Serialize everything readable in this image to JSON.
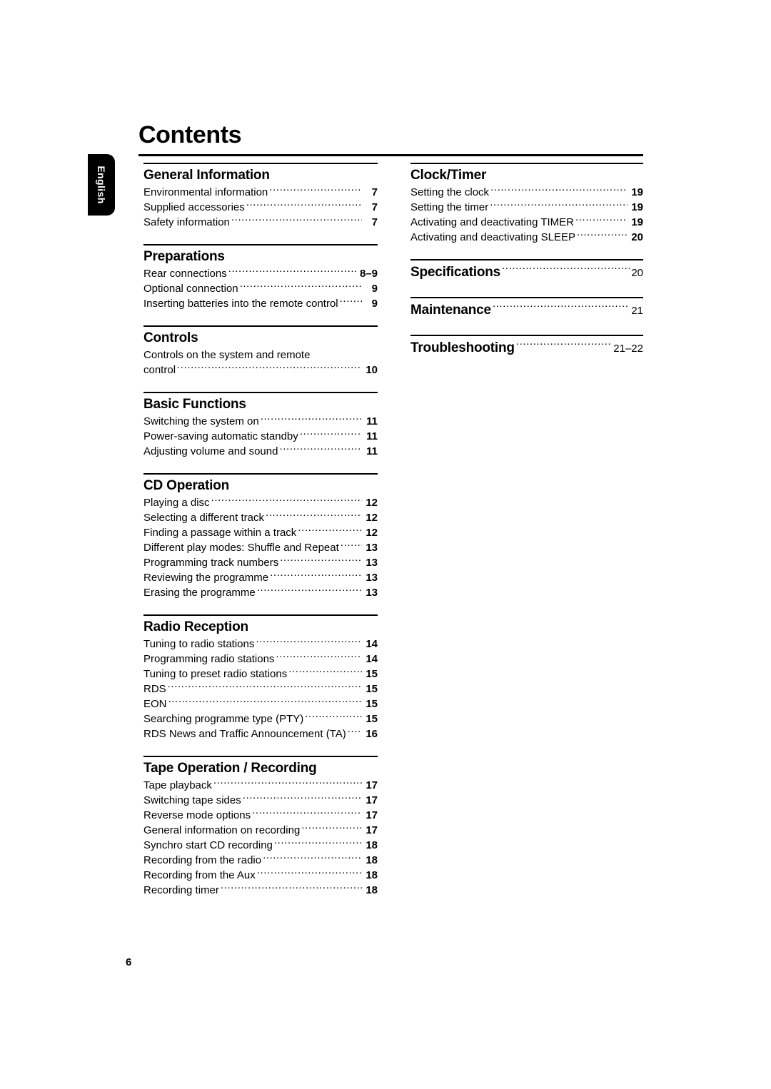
{
  "document": {
    "title": "Contents",
    "folio": "6",
    "language_tab": "English"
  },
  "left_column": {
    "sections": [
      {
        "title": "General Information",
        "entries": [
          {
            "label": "Environmental information",
            "page": "7"
          },
          {
            "label": "Supplied accessories",
            "page": "7"
          },
          {
            "label": "Safety information",
            "page": "7"
          }
        ]
      },
      {
        "title": "Preparations",
        "entries": [
          {
            "label": "Rear connections",
            "page": "8–9"
          },
          {
            "label": "Optional connection",
            "page": "9"
          },
          {
            "label": "Inserting batteries into the remote control",
            "page": "9"
          }
        ]
      },
      {
        "title": "Controls",
        "wrapped_entry": {
          "line1": "Controls on the system and remote",
          "line2": "control",
          "page": "10"
        },
        "entries": []
      },
      {
        "title": "Basic Functions",
        "entries": [
          {
            "label": "Switching the system on",
            "page": "11"
          },
          {
            "label": "Power-saving automatic standby",
            "page": "11"
          },
          {
            "label": "Adjusting volume and sound",
            "page": "11"
          }
        ]
      },
      {
        "title": "CD Operation",
        "entries": [
          {
            "label": "Playing a disc",
            "page": "12"
          },
          {
            "label": "Selecting a different track",
            "page": "12"
          },
          {
            "label": "Finding a passage within a track",
            "page": "12"
          },
          {
            "label": "Different play modes: Shuffle and Repeat",
            "page": "13"
          },
          {
            "label": "Programming track numbers",
            "page": "13"
          },
          {
            "label": "Reviewing the programme",
            "page": "13"
          },
          {
            "label": "Erasing the programme",
            "page": "13"
          }
        ]
      },
      {
        "title": "Radio Reception",
        "entries": [
          {
            "label": "Tuning to radio stations",
            "page": "14"
          },
          {
            "label": "Programming radio stations",
            "page": "14"
          },
          {
            "label": "Tuning to preset radio stations",
            "page": "15"
          },
          {
            "label": "RDS",
            "page": "15"
          },
          {
            "label": "EON",
            "page": "15"
          },
          {
            "label": "Searching programme type (PTY)",
            "page": "15"
          },
          {
            "label": "RDS News and Traffic Announcement (TA)",
            "page": "16"
          }
        ]
      },
      {
        "title": "Tape Operation / Recording",
        "entries": [
          {
            "label": "Tape playback",
            "page": "17"
          },
          {
            "label": "Switching tape sides",
            "page": "17"
          },
          {
            "label": "Reverse mode options",
            "page": "17"
          },
          {
            "label": "General information on recording",
            "page": "17"
          },
          {
            "label": "Synchro start CD recording",
            "page": "18"
          },
          {
            "label": "Recording from the radio",
            "page": "18"
          },
          {
            "label": "Recording from the Aux",
            "page": "18"
          },
          {
            "label": "Recording timer",
            "page": "18"
          }
        ]
      }
    ]
  },
  "right_column": {
    "sections": [
      {
        "title": "Clock/Timer",
        "entries": [
          {
            "label": "Setting the clock",
            "page": "19"
          },
          {
            "label": "Setting the timer",
            "page": "19"
          },
          {
            "label": "Activating and deactivating TIMER",
            "page": "19"
          },
          {
            "label": "Activating and deactivating SLEEP",
            "page": "20"
          }
        ]
      },
      {
        "title": "Specifications",
        "title_page": "20",
        "entries": []
      },
      {
        "title": "Maintenance",
        "title_page": "21",
        "entries": []
      },
      {
        "title": "Troubleshooting",
        "title_page": "21–22",
        "entries": []
      }
    ]
  }
}
